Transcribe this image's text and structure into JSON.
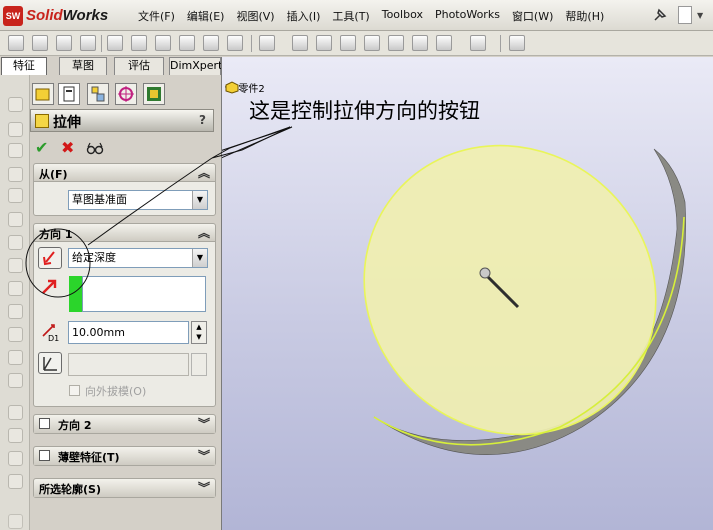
{
  "app": {
    "brand_prefix": "Solid",
    "brand_suffix": "Works",
    "logo_text": "SW"
  },
  "menu": [
    "文件(F)",
    "编辑(E)",
    "视图(V)",
    "插入(I)",
    "工具(T)",
    "Toolbox",
    "PhotoWorks",
    "窗口(W)",
    "帮助(H)"
  ],
  "tabs": [
    "特征",
    "草图",
    "评估",
    "DimXpert"
  ],
  "active_tab": "特征",
  "feature": {
    "title": "拉伸",
    "help": "?",
    "from_group": {
      "label": "从(F)",
      "value": "草图基准面"
    },
    "direction1": {
      "label": "方向 1",
      "end_condition": "给定深度",
      "depth": "10.00mm",
      "draft_label": "向外拔模(O)"
    },
    "direction2": {
      "label": "方向 2"
    },
    "thin_feature": {
      "label": "薄壁特征(T)"
    },
    "selected_contours": {
      "label": "所选轮廓(S)"
    }
  },
  "graphics": {
    "part_name": "零件2",
    "annotation": "这是控制拉伸方向的按钮"
  },
  "colors": {
    "disc_face": "#f0efb0",
    "disc_side": "#8a8a84",
    "edge_highlight": "#e9f55a",
    "depth_color_box": "#2bd52b",
    "reverse_arrow": "#e02020",
    "viewport_bg": "#c9cbe3"
  },
  "icons": [
    "pin-icon",
    "new-document-icon",
    "ok-check-icon",
    "cancel-x-icon",
    "preview-glasses-icon",
    "reverse-direction-icon",
    "direction-arrow-icon",
    "depth-d1-icon",
    "draft-icon"
  ]
}
